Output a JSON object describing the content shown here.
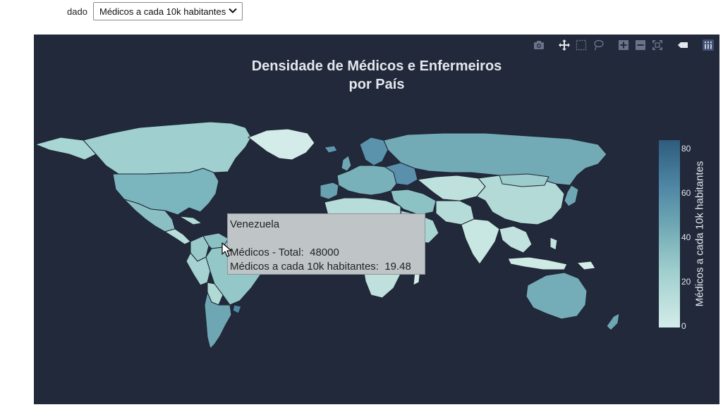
{
  "controls": {
    "label": "dado",
    "selected": "Médicos a cada 10k habitantes"
  },
  "chart": {
    "title_line1": "Densidade de Médicos e Enfermeiros",
    "title_line2": "por País",
    "background_color": "#21293a"
  },
  "colorbar": {
    "title": "Médicos a cada 10k habitantes",
    "ticks": [
      "0",
      "20",
      "40",
      "60",
      "80"
    ],
    "range": [
      0,
      85
    ],
    "color_low": "#d3ece9",
    "color_high": "#2e5c7c"
  },
  "tooltip": {
    "country": "Venezuela",
    "row1_label": "Médicos - Total:",
    "row1_value": "48000",
    "row2_label": "Médicos a cada 10k habitantes:",
    "row2_value": "19.48"
  },
  "modebar": [
    {
      "icon": "camera-icon"
    },
    {
      "icon": "pan-icon"
    },
    {
      "icon": "box-select-icon"
    },
    {
      "icon": "lasso-icon"
    },
    {
      "icon": "zoom-in-icon"
    },
    {
      "icon": "zoom-out-icon"
    },
    {
      "icon": "reset-icon"
    },
    {
      "icon": "hover-icon"
    },
    {
      "icon": "plotly-logo-icon"
    }
  ]
}
